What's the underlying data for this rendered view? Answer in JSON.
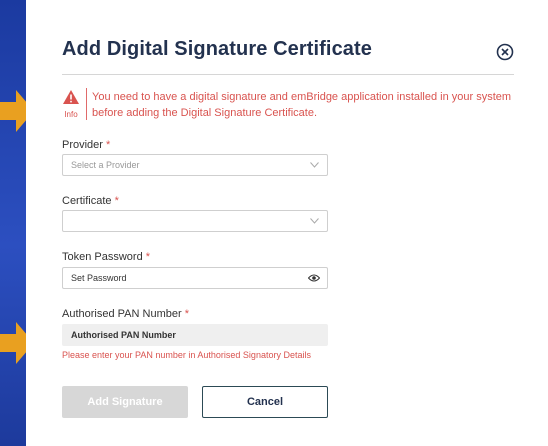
{
  "dialog": {
    "title": "Add Digital Signature Certificate"
  },
  "alert": {
    "caption": "Info",
    "message": "You need to have a digital signature and emBridge application installed in your system before adding the Digital Signature Certificate."
  },
  "form": {
    "required_mark": "*",
    "provider": {
      "label": "Provider",
      "placeholder": "Select a Provider"
    },
    "certificate": {
      "label": "Certificate",
      "value": ""
    },
    "token_password": {
      "label": "Token Password",
      "placeholder": "Set Password"
    },
    "pan": {
      "label": "Authorised PAN Number",
      "value": "Authorised PAN Number",
      "error": "Please enter your PAN number in Authorised Signatory Details"
    }
  },
  "actions": {
    "add_label": "Add Signature",
    "cancel_label": "Cancel"
  },
  "colors": {
    "brand_navy": "#23324f",
    "error_red": "#d9534f",
    "arrow_orange": "#e9a020",
    "sidebar_blue": "#2c4fc0"
  },
  "icons": {
    "close": "close-circle-icon",
    "alert": "warning-triangle-icon",
    "dropdown": "chevron-down-icon",
    "password": "eye-icon",
    "pointer": "arrow-right-icon"
  }
}
